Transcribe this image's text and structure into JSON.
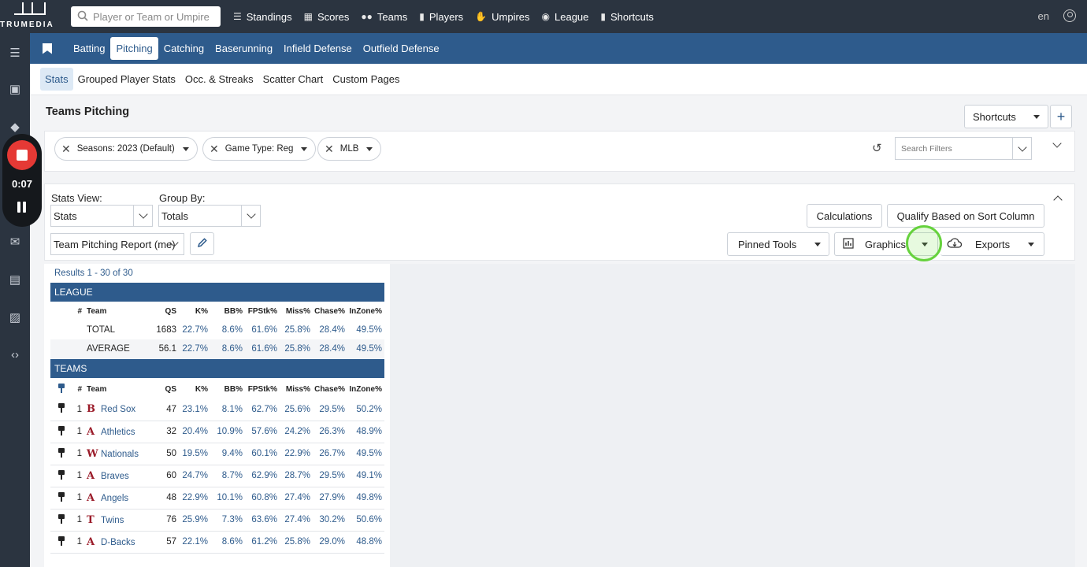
{
  "brand": {
    "name": "TRUMEDIA"
  },
  "search": {
    "placeholder": "Player or Team or Umpire"
  },
  "topnav": [
    {
      "label": "Standings",
      "icon": "list-icon"
    },
    {
      "label": "Scores",
      "icon": "grid-icon"
    },
    {
      "label": "Teams",
      "icon": "people-icon"
    },
    {
      "label": "Players",
      "icon": "person-icon"
    },
    {
      "label": "Umpires",
      "icon": "thumbs-icon"
    },
    {
      "label": "League",
      "icon": "globe-icon"
    },
    {
      "label": "Shortcuts",
      "icon": "bookmark-icon"
    }
  ],
  "language": "en",
  "recorder": {
    "time": "0:07"
  },
  "tabs": [
    "Batting",
    "Pitching",
    "Catching",
    "Baserunning",
    "Infield Defense",
    "Outfield Defense"
  ],
  "subtabs": [
    "Stats",
    "Grouped Player Stats",
    "Occ. & Streaks",
    "Scatter Chart",
    "Custom Pages"
  ],
  "page": {
    "title": "Teams Pitching",
    "shortcuts": "Shortcuts",
    "add": "+"
  },
  "filters": {
    "chips": [
      "Seasons: 2023 (Default)",
      "Game Type: Reg",
      "MLB"
    ],
    "search_placeholder": "Search Filters"
  },
  "view": {
    "stats_view_label": "Stats View:",
    "stats_view_value": "Stats",
    "group_by_label": "Group By:",
    "group_by_value": "Totals",
    "report": "Team Pitching Report (me)",
    "calculations": "Calculations",
    "qualify": "Qualify Based on Sort Column",
    "pinned_tools": "Pinned Tools",
    "graphics": "Graphics",
    "exports": "Exports"
  },
  "results": {
    "label": "Results 1 - 30 of 30"
  },
  "columns": [
    "#",
    "Team",
    "QS",
    "K%",
    "BB%",
    "FPStk%",
    "Miss%",
    "Chase%",
    "InZone%"
  ],
  "league": {
    "heading": "LEAGUE",
    "rows": [
      {
        "name": "TOTAL",
        "qs": "1683",
        "k": "22.7%",
        "bb": "8.6%",
        "fp": "61.6%",
        "miss": "25.8%",
        "chase": "28.4%",
        "inzone": "49.5%"
      },
      {
        "name": "AVERAGE",
        "qs": "56.1",
        "k": "22.7%",
        "bb": "8.6%",
        "fp": "61.6%",
        "miss": "25.8%",
        "chase": "28.4%",
        "inzone": "49.5%"
      }
    ]
  },
  "teams": {
    "heading": "TEAMS",
    "rows": [
      {
        "rank": "1",
        "logo": "B",
        "name": "Red Sox",
        "qs": "47",
        "k": "23.1%",
        "bb": "8.1%",
        "fp": "62.7%",
        "miss": "25.6%",
        "chase": "29.5%",
        "inzone": "50.2%"
      },
      {
        "rank": "1",
        "logo": "A",
        "name": "Athletics",
        "qs": "32",
        "k": "20.4%",
        "bb": "10.9%",
        "fp": "57.6%",
        "miss": "24.2%",
        "chase": "26.3%",
        "inzone": "48.9%"
      },
      {
        "rank": "1",
        "logo": "W",
        "name": "Nationals",
        "qs": "50",
        "k": "19.5%",
        "bb": "9.4%",
        "fp": "60.1%",
        "miss": "22.9%",
        "chase": "26.7%",
        "inzone": "49.5%"
      },
      {
        "rank": "1",
        "logo": "A",
        "name": "Braves",
        "qs": "60",
        "k": "24.7%",
        "bb": "8.7%",
        "fp": "62.9%",
        "miss": "28.7%",
        "chase": "29.5%",
        "inzone": "49.1%"
      },
      {
        "rank": "1",
        "logo": "A",
        "name": "Angels",
        "qs": "48",
        "k": "22.9%",
        "bb": "10.1%",
        "fp": "60.8%",
        "miss": "27.4%",
        "chase": "27.9%",
        "inzone": "49.8%"
      },
      {
        "rank": "1",
        "logo": "T",
        "name": "Twins",
        "qs": "76",
        "k": "25.9%",
        "bb": "7.3%",
        "fp": "63.6%",
        "miss": "27.4%",
        "chase": "30.2%",
        "inzone": "50.6%"
      },
      {
        "rank": "1",
        "logo": "A",
        "name": "D-Backs",
        "qs": "57",
        "k": "22.1%",
        "bb": "8.6%",
        "fp": "61.2%",
        "miss": "25.8%",
        "chase": "29.0%",
        "inzone": "48.8%"
      }
    ]
  },
  "colors": {
    "topbar": "#2b3440",
    "tabbar": "#2e5b8c",
    "accent": "#2e5b8c",
    "record": "#e53935",
    "cursor_ring": "#66d23d"
  }
}
